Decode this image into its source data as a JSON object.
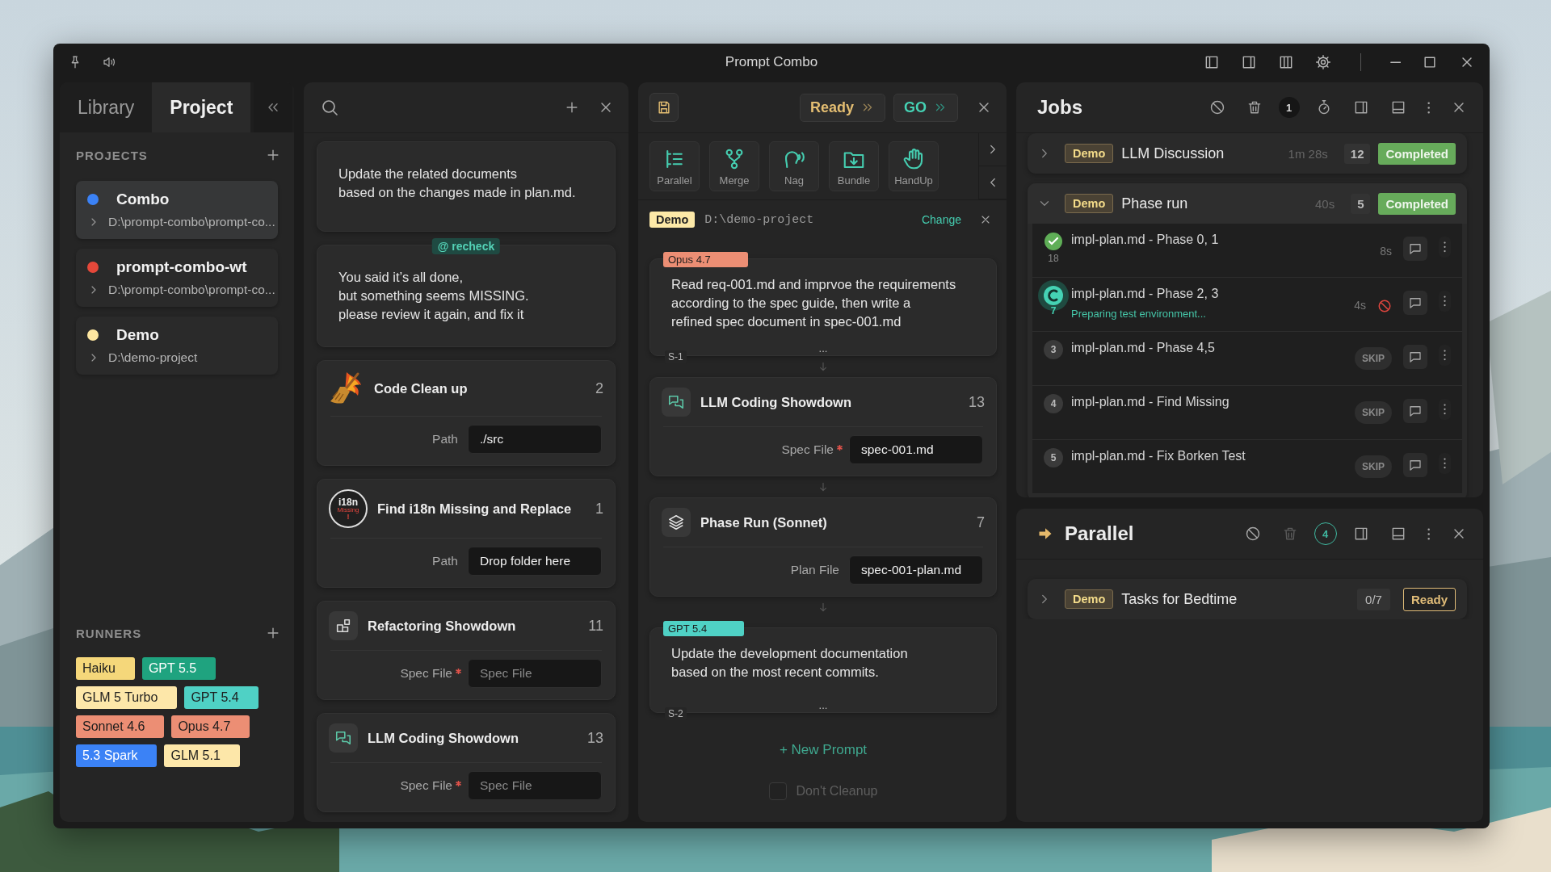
{
  "window": {
    "title": "Prompt Combo"
  },
  "sidebar": {
    "tabs": [
      {
        "label": "Library",
        "selected": false
      },
      {
        "label": "Project",
        "selected": true
      }
    ],
    "projects_heading": "PROJECTS",
    "projects": [
      {
        "name": "Combo",
        "path": "D:\\prompt-combo\\prompt-co...",
        "color": "#3b82f6",
        "selected": true
      },
      {
        "name": "prompt-combo-wt",
        "path": "D:\\prompt-combo\\prompt-co...",
        "color": "#e5483a",
        "selected": false
      },
      {
        "name": "Demo",
        "path": "D:\\demo-project",
        "color": "#fde6a0",
        "selected": false
      }
    ],
    "runners_heading": "RUNNERS",
    "runners": [
      {
        "label": "Haiku",
        "color": "#f5d77a"
      },
      {
        "label": "GPT 5.5",
        "color": "#1fa37f"
      },
      {
        "label": "GLM 5 Turbo",
        "color": "#fde7a9"
      },
      {
        "label": "GPT 5.4",
        "color": "#4fd1c5"
      },
      {
        "label": "Sonnet 4.6",
        "color": "#ec8e74"
      },
      {
        "label": "Opus 4.7",
        "color": "#ec8e74"
      },
      {
        "label": "5.3 Spark",
        "color": "#3b82f6"
      },
      {
        "label": "GLM 5.1",
        "color": "#fde7a9"
      }
    ]
  },
  "library": {
    "cards": [
      {
        "kind": "prompt",
        "text": "Update the related documents\nbased on the changes made in plan.md."
      },
      {
        "kind": "prompt",
        "tag": "@ recheck",
        "text": "You said it’s all done,\nbut something seems MISSING.\nplease review it again, and fix it"
      },
      {
        "kind": "combo",
        "title": "Code Clean up",
        "count": "2",
        "field": {
          "label": "Path",
          "required": false,
          "value": "./src"
        }
      },
      {
        "kind": "combo",
        "title": "Find i18n Missing and Replace",
        "count": "1",
        "logo": {
          "text": "i18n",
          "subtext": "Missing",
          "mark": "!"
        },
        "field": {
          "label": "Path",
          "required": false,
          "value": "Drop folder here"
        }
      },
      {
        "kind": "combo",
        "title": "Refactoring Showdown",
        "count": "11",
        "field": {
          "label": "Spec File",
          "required": true,
          "placeholder": "Spec File"
        }
      },
      {
        "kind": "combo",
        "title": "LLM Coding Showdown",
        "count": "13",
        "field": {
          "label": "Spec File",
          "required": true,
          "placeholder": "Spec File"
        }
      }
    ]
  },
  "workflow": {
    "status_button": "Ready",
    "go_button": "GO",
    "tools": [
      "Parallel",
      "Merge",
      "Nag",
      "Bundle",
      "HandUp"
    ],
    "project": {
      "tag": "Demo",
      "path": "D:\\demo-project",
      "action": "Change"
    },
    "steps": [
      {
        "kind": "prompt",
        "runner": {
          "label": "Opus 4.7",
          "color": "#ec8e74"
        },
        "text": "Read req-001.md and imprvoe the requirements\naccording to the spec guide, then write a\nrefined spec document in spec-001.md",
        "label": "S-1",
        "more": "..."
      },
      {
        "kind": "combo",
        "title": "LLM Coding Showdown",
        "count": "13",
        "field": {
          "label": "Spec File",
          "required": true,
          "value": "spec-001.md"
        }
      },
      {
        "kind": "combo",
        "title": "Phase Run (Sonnet)",
        "count": "7",
        "field": {
          "label": "Plan File",
          "required": false,
          "value": "spec-001-plan.md"
        }
      },
      {
        "kind": "prompt",
        "runner": {
          "label": "GPT 5.4",
          "color": "#4fd1c5"
        },
        "text": "Update the development documentation\nbased on the most recent commits.",
        "label": "S-2",
        "more": "..."
      }
    ],
    "new_prompt": "+ New Prompt",
    "cleanup": {
      "label": "Don't Cleanup",
      "checked": false
    }
  },
  "jobs": {
    "title": "Jobs",
    "count_badge": "1",
    "items": [
      {
        "tag": "Demo",
        "title": "LLM Discussion",
        "duration": "1m 28s",
        "count": "12",
        "status": {
          "label": "Completed",
          "kind": "completed"
        },
        "expanded": false
      },
      {
        "tag": "Demo",
        "title": "Phase run",
        "duration": "40s",
        "count": "5",
        "status": {
          "label": "Completed",
          "kind": "completed"
        },
        "expanded": true,
        "steps": [
          {
            "kind": "done",
            "number": "18",
            "title": "impl-plan.md - Phase 0, 1",
            "time": "8s"
          },
          {
            "kind": "running",
            "number": "7",
            "title": "impl-plan.md - Phase 2, 3",
            "detail": "Preparing test environment...",
            "time": "4s"
          },
          {
            "kind": "pending",
            "number": "3",
            "title": "impl-plan.md - Phase 4,5",
            "skip": "SKIP"
          },
          {
            "kind": "pending",
            "number": "4",
            "title": "impl-plan.md - Find Missing",
            "skip": "SKIP"
          },
          {
            "kind": "pending",
            "number": "5",
            "title": "impl-plan.md - Fix Borken Test",
            "skip": "SKIP"
          }
        ]
      }
    ]
  },
  "parallel": {
    "title": "Parallel",
    "count_badge": "4",
    "items": [
      {
        "tag": "Demo",
        "title": "Tasks for Bedtime",
        "progress": "0/7",
        "status": {
          "label": "Ready",
          "kind": "ready"
        },
        "expanded": false
      }
    ]
  }
}
